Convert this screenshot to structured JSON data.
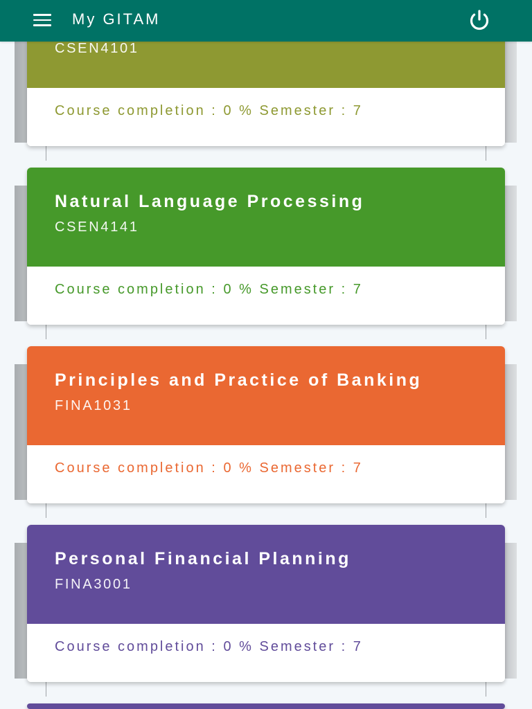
{
  "page": {
    "background_color": "#F3F7FA"
  },
  "app_bar": {
    "title": "My GITAM",
    "menu_icon": "hamburger-menu-icon",
    "logout_icon": "power-icon",
    "background_color": "#007265"
  },
  "labels": {
    "completion": "Course completion :",
    "percent": "%",
    "semester": "Semester :"
  },
  "courses": [
    {
      "code": "CSEN4101",
      "completion_percent": 0,
      "semester": 7,
      "color": "#8E9932"
    },
    {
      "title": "Natural Language Processing",
      "code": "CSEN4141",
      "completion_percent": 0,
      "semester": 7,
      "color": "#46992A"
    },
    {
      "title": "Principles and Practice of Banking",
      "code": "FINA1031",
      "completion_percent": 0,
      "semester": 7,
      "color": "#EA6832"
    },
    {
      "title": "Personal Financial Planning",
      "code": "FINA3001",
      "completion_percent": 0,
      "semester": 7,
      "color": "#614C9A"
    },
    {
      "color": "#614C9A"
    }
  ]
}
